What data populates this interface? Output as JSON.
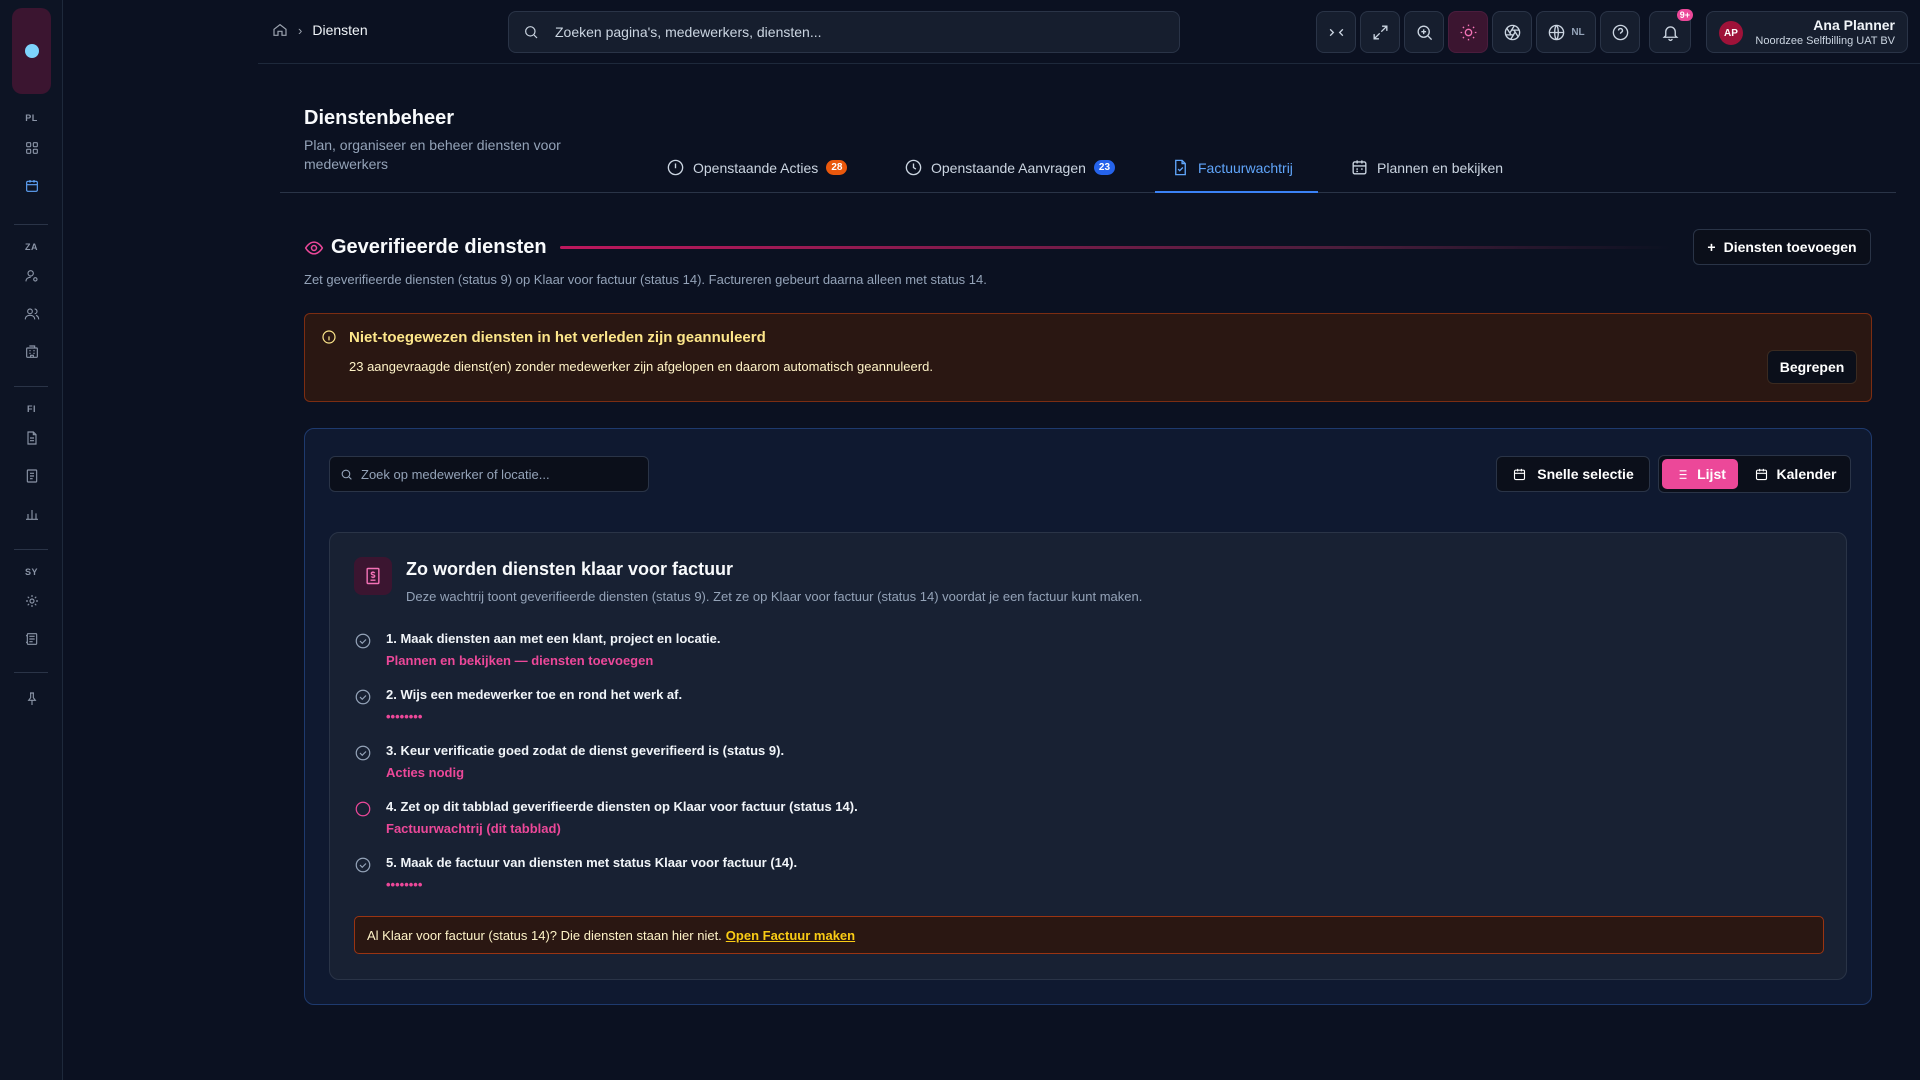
{
  "sidebar": {
    "sections": [
      "PL",
      "ZA",
      "FI",
      "SY"
    ]
  },
  "topbar": {
    "breadcrumb": "Diensten",
    "search_placeholder": "Zoeken pagina's, medewerkers, diensten...",
    "language": "NL",
    "notifications": "9+",
    "user": {
      "initials": "AP",
      "name": "Ana Planner",
      "org": "Noordzee Selfbilling UAT BV"
    }
  },
  "header": {
    "title": "Dienstenbeheer",
    "subtitle": "Plan, organiseer en beheer diensten voor medewerkers",
    "tabs": [
      {
        "label": "Openstaande Acties",
        "badge": "28"
      },
      {
        "label": "Openstaande Aanvragen",
        "badge": "23"
      },
      {
        "label": "Factuurwachtrij",
        "badge": ""
      },
      {
        "label": "Plannen en bekijken",
        "badge": ""
      }
    ]
  },
  "section": {
    "title": "Geverifieerde diensten",
    "add_button": "Diensten toevoegen",
    "description": "Zet geverifieerde diensten (status 9) op Klaar voor factuur (status 14). Factureren gebeurt daarna alleen met status 14."
  },
  "alert": {
    "title": "Niet-toegewezen diensten in het verleden zijn geannuleerd",
    "text": "23 aangevraagde dienst(en) zonder medewerker zijn afgelopen en daarom automatisch geannuleerd.",
    "button": "Begrepen"
  },
  "panel": {
    "search_placeholder": "Zoek op medewerker of locatie...",
    "quick_select": "Snelle selectie",
    "view_list": "Lijst",
    "view_calendar": "Kalender",
    "guide": {
      "title": "Zo worden diensten klaar voor factuur",
      "description": "Deze wachtrij toont geverifieerde diensten (status 9). Zet ze op Klaar voor factuur (status 14) voordat je een factuur kunt maken.",
      "steps": [
        {
          "title": "1. Maak diensten aan met een klant, project en locatie.",
          "link": "Plannen en bekijken — diensten toevoegen",
          "state": "done"
        },
        {
          "title": "2. Wijs een medewerker toe en rond het werk af.",
          "link": "••••••••",
          "state": "done"
        },
        {
          "title": "3. Keur verificatie goed zodat de dienst geverifieerd is (status 9).",
          "link": "Acties nodig",
          "state": "done"
        },
        {
          "title": "4. Zet op dit tabblad geverifieerde diensten op Klaar voor factuur (status 14).",
          "link": "Factuurwachtrij (dit tabblad)",
          "state": "current"
        },
        {
          "title": "5. Maak de factuur van diensten met status Klaar voor factuur (14).",
          "link": "••••••••",
          "state": "done"
        }
      ],
      "note_text": "Al Klaar voor factuur (status 14)? Die diensten staan hier niet.",
      "note_link": "Open Factuur maken"
    }
  },
  "colors": {
    "accent": "#ec4899",
    "active_tab": "#3b82f6",
    "badge_orange": "#ea580c",
    "badge_blue": "#2563eb"
  }
}
